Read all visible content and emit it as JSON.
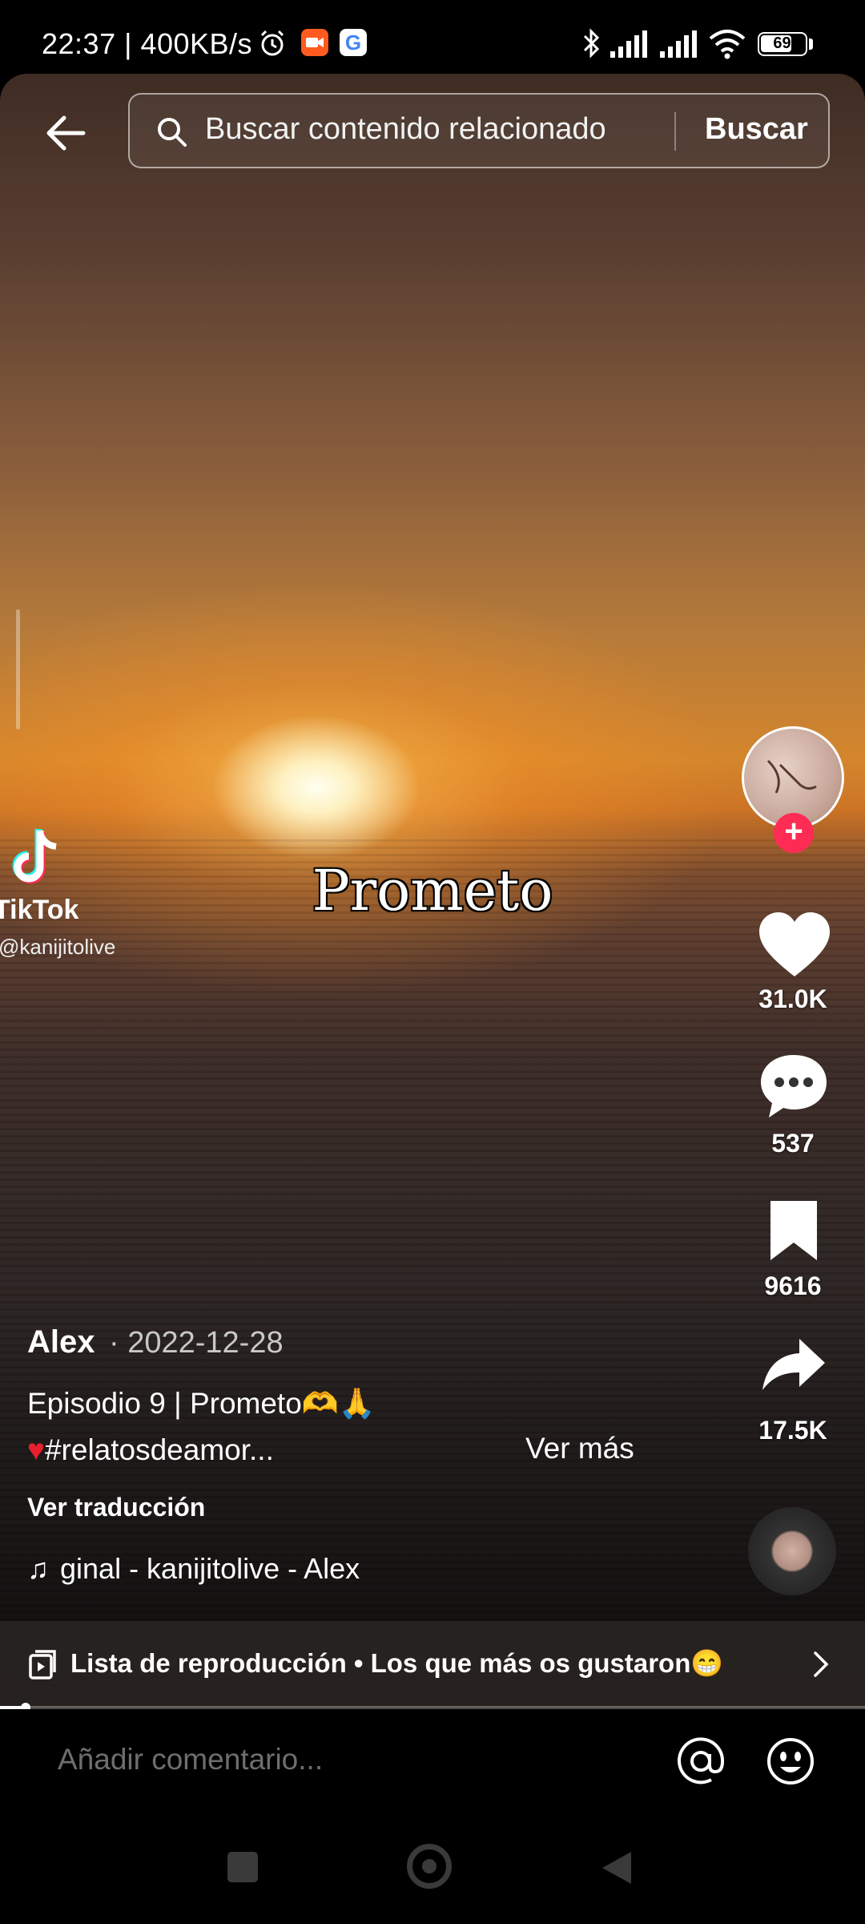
{
  "status_bar": {
    "time_speed": "22:37 | 400KB/s",
    "battery": "69"
  },
  "search": {
    "placeholder": "Buscar contenido relacionado",
    "button": "Buscar"
  },
  "watermark": {
    "brand": "TikTok",
    "handle": "@kanijitolive"
  },
  "overlay_caption": "Prometo",
  "actions": {
    "likes": "31.0K",
    "comments": "537",
    "saves": "9616",
    "shares": "17.5K"
  },
  "post": {
    "author": "Alex",
    "date": "· 2022-12-28",
    "caption_line1": "Episodio 9 | Prometo🫶🙏",
    "caption_line2": "♥#relatosdeamor...",
    "see_more": "Ver más",
    "translate": "Ver traducción",
    "sound": "ginal - kanijitolive - Alex"
  },
  "playlist": {
    "label": "Lista de reproducción • Los que más os gustaron😁"
  },
  "playback": {
    "progress": 0.03
  },
  "comment_bar": {
    "placeholder": "Añadir comentario..."
  },
  "colors": {
    "accent": "#fe2c55",
    "sun": "#fff6d8",
    "sky_orange": "#d4862c"
  }
}
